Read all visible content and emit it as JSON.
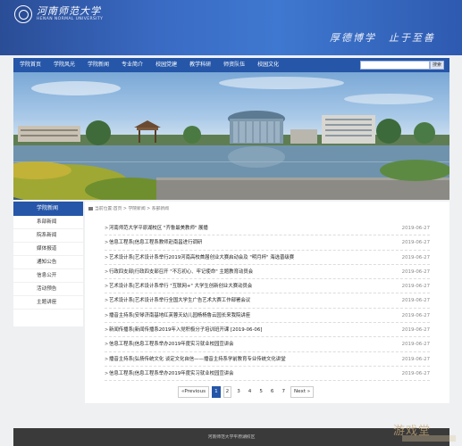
{
  "header": {
    "logo_cn": "河南师范大学",
    "logo_en": "HENAN NORMAL UNIVERSITY",
    "motto_left": "厚德博学",
    "motto_right": "止于至善"
  },
  "nav": {
    "items": [
      {
        "label": "学院首页"
      },
      {
        "label": "学院风光"
      },
      {
        "label": "学院新闻"
      },
      {
        "label": "专业简介"
      },
      {
        "label": "校园党建"
      },
      {
        "label": "教学科研"
      },
      {
        "label": "师资队伍"
      },
      {
        "label": "校园文化"
      }
    ],
    "search_placeholder": "",
    "search_button": "搜索"
  },
  "sidebar": {
    "title": "学院新闻",
    "items": [
      {
        "label": "系部新闻"
      },
      {
        "label": "院系新闻"
      },
      {
        "label": "媒体报道"
      },
      {
        "label": "通知公告"
      },
      {
        "label": "信息公开"
      },
      {
        "label": "活动预告"
      },
      {
        "label": "主题讲座"
      }
    ]
  },
  "breadcrumb": "当前位置:首页 > 学院新闻 > 系部新闻",
  "news": [
    {
      "title": "河南师范大学平原湖校区 \"齐鲁最美教师\" 展播",
      "date": "2019-06-27"
    },
    {
      "title": "信息工程系|信息工程系教师赴南昌进行调研",
      "date": "2019-06-27"
    },
    {
      "title": "艺术设计系|艺术设计系举行2019河南高校首届创业大赛启动会及 \"明月杯\" 海选晋级赛",
      "date": "2019-06-27"
    },
    {
      "title": "行政四支部|行政四支部召开 \"不忘初心、牢记使命\" 主题教育动员会",
      "date": "2019-06-27"
    },
    {
      "title": "艺术设计系|艺术设计系举行 \"互联网+\" 大学生创新创业大赛动员会",
      "date": "2019-06-27"
    },
    {
      "title": "艺术设计系|艺术设计系举行全国大学生广告艺术大赛工作部署会议",
      "date": "2019-06-27"
    },
    {
      "title": "播音主持系|安琴济南基地红芙蓉天幼儿园杨杨鲁云园长来我院讲座",
      "date": "2019-06-27"
    },
    {
      "title": "新闻传播系|新闻传播系2019年入党积极分子培训班开课 [2019-06-06]",
      "date": "2019-06-27"
    },
    {
      "title": "信息工程系|信息工程系举办2019年度实习就业校园宣讲会",
      "date": "2019-06-27"
    },
    {
      "title": "播音主持系|弘扬传统文化 谈定文化自信——播音主持系学前教育专业传统文化讲堂",
      "date": "2019-06-27"
    },
    {
      "title": "信息工程系|信息工程系举办2019年度实习就业校园宣讲会",
      "date": "2019-06-27"
    }
  ],
  "pager": {
    "prev": "«Previous",
    "pages": [
      "1",
      "2",
      "3",
      "4",
      "5",
      "6",
      "7"
    ],
    "current": "1",
    "next": "Next »"
  },
  "footer": {
    "text": "河南师范大学平原湖校区"
  },
  "watermark": "游戏堂"
}
